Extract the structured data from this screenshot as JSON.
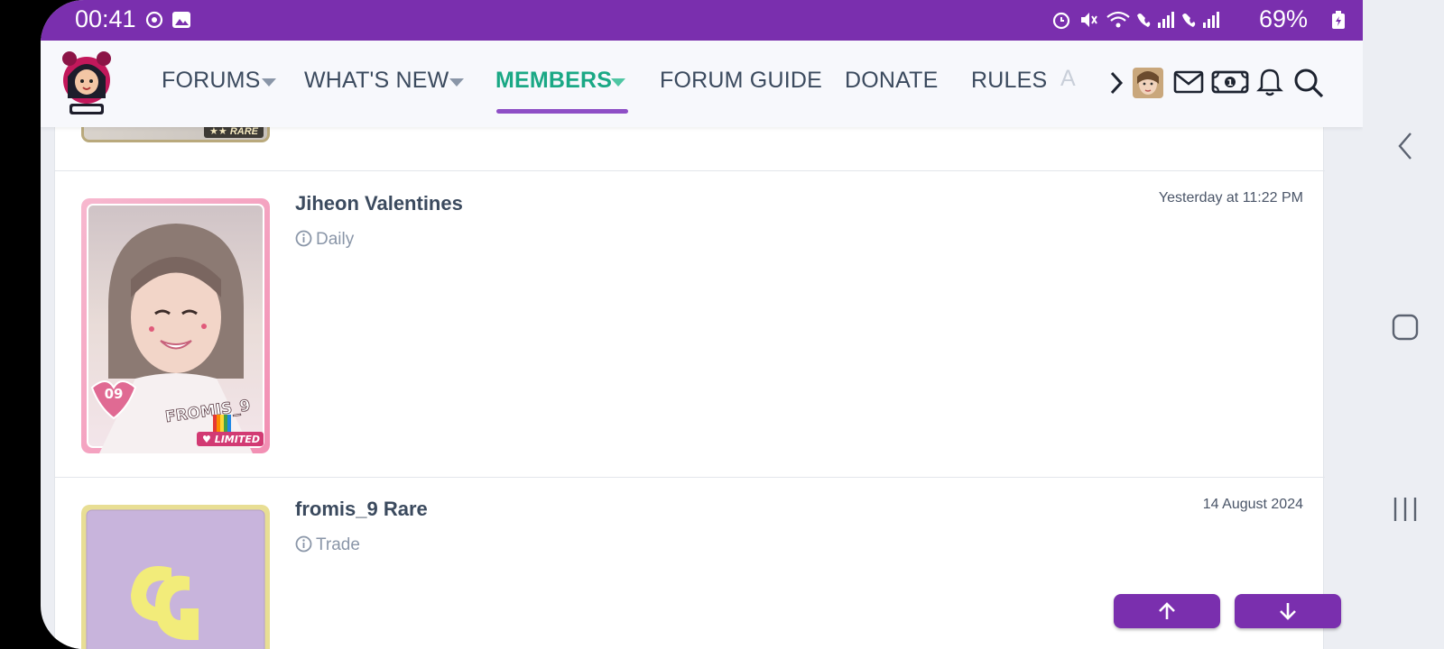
{
  "status_bar": {
    "time": "00:41",
    "battery": "69%"
  },
  "nav": {
    "items": [
      {
        "label": "FORUMS",
        "has_caret": true
      },
      {
        "label": "WHAT'S NEW",
        "has_caret": true
      },
      {
        "label": "MEMBERS",
        "has_caret": true,
        "active": true
      },
      {
        "label": "FORUM GUIDE",
        "has_caret": false
      },
      {
        "label": "DONATE",
        "has_caret": false
      },
      {
        "label": "RULES",
        "has_caret": false
      }
    ],
    "overflow_label": "A",
    "accent_color": "#7a2fae",
    "active_color": "#1aa885"
  },
  "previous_card": {
    "badge_label": "RARE"
  },
  "items": [
    {
      "title": "Jiheon Valentines",
      "meta": "Daily",
      "date": "Yesterday at 11:22 PM",
      "card": {
        "number": "09",
        "group": "FROMIS_9",
        "rarity": "LIMITED"
      }
    },
    {
      "title": "fromis_9 Rare",
      "meta": "Trade",
      "date": "14 August 2024"
    }
  ],
  "icons": {
    "nav": [
      "chevron-right-icon",
      "avatar",
      "envelope-icon",
      "cash-icon",
      "bell-icon",
      "search-icon"
    ],
    "scroll": [
      "arrow-up-icon",
      "arrow-down-icon"
    ]
  }
}
